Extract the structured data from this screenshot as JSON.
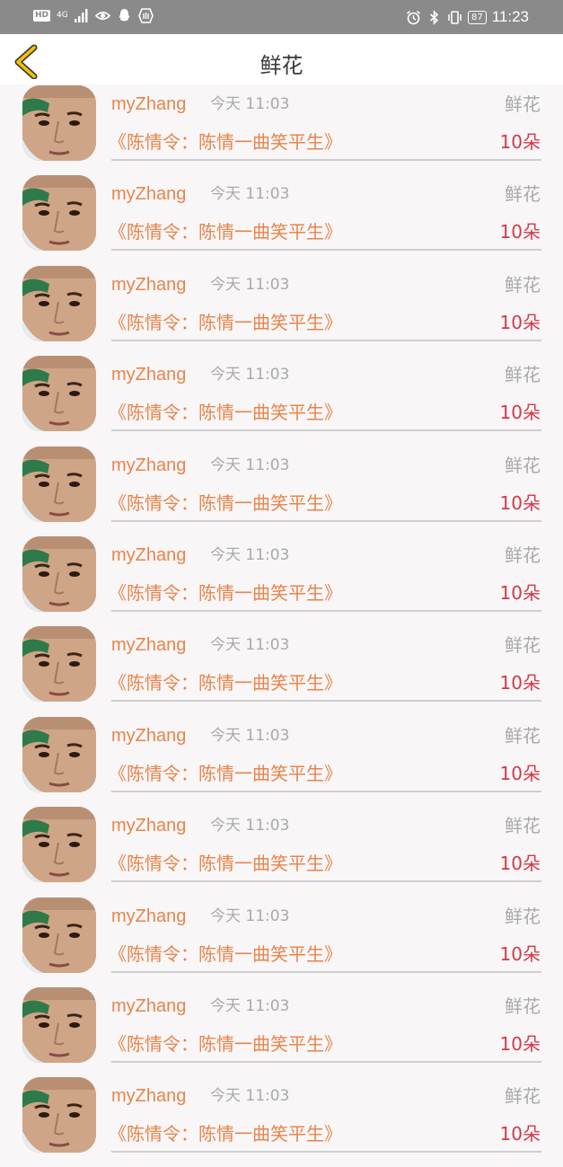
{
  "status_bar": {
    "hd": "HD",
    "network": "4G",
    "battery": "87",
    "time": "11:23"
  },
  "header": {
    "title": "鲜花",
    "back_icon": "chevron-left-icon",
    "accent_color": "#f2c200"
  },
  "colors": {
    "name": "#e8844a",
    "count": "#d23a4a",
    "meta": "#a9a9a9"
  },
  "records": [
    {
      "user": "myZhang",
      "time": "今天 11:03",
      "gift_type": "鲜花",
      "work": "《陈情令：陈情一曲笑平生》",
      "count": "10朵"
    },
    {
      "user": "myZhang",
      "time": "今天 11:03",
      "gift_type": "鲜花",
      "work": "《陈情令：陈情一曲笑平生》",
      "count": "10朵"
    },
    {
      "user": "myZhang",
      "time": "今天 11:03",
      "gift_type": "鲜花",
      "work": "《陈情令：陈情一曲笑平生》",
      "count": "10朵"
    },
    {
      "user": "myZhang",
      "time": "今天 11:03",
      "gift_type": "鲜花",
      "work": "《陈情令：陈情一曲笑平生》",
      "count": "10朵"
    },
    {
      "user": "myZhang",
      "time": "今天 11:03",
      "gift_type": "鲜花",
      "work": "《陈情令：陈情一曲笑平生》",
      "count": "10朵"
    },
    {
      "user": "myZhang",
      "time": "今天 11:03",
      "gift_type": "鲜花",
      "work": "《陈情令：陈情一曲笑平生》",
      "count": "10朵"
    },
    {
      "user": "myZhang",
      "time": "今天 11:03",
      "gift_type": "鲜花",
      "work": "《陈情令：陈情一曲笑平生》",
      "count": "10朵"
    },
    {
      "user": "myZhang",
      "time": "今天 11:03",
      "gift_type": "鲜花",
      "work": "《陈情令：陈情一曲笑平生》",
      "count": "10朵"
    },
    {
      "user": "myZhang",
      "time": "今天 11:03",
      "gift_type": "鲜花",
      "work": "《陈情令：陈情一曲笑平生》",
      "count": "10朵"
    },
    {
      "user": "myZhang",
      "time": "今天 11:03",
      "gift_type": "鲜花",
      "work": "《陈情令：陈情一曲笑平生》",
      "count": "10朵"
    },
    {
      "user": "myZhang",
      "time": "今天 11:03",
      "gift_type": "鲜花",
      "work": "《陈情令：陈情一曲笑平生》",
      "count": "10朵"
    },
    {
      "user": "myZhang",
      "time": "今天 11:03",
      "gift_type": "鲜花",
      "work": "《陈情令：陈情一曲笑平生》",
      "count": "10朵"
    }
  ]
}
